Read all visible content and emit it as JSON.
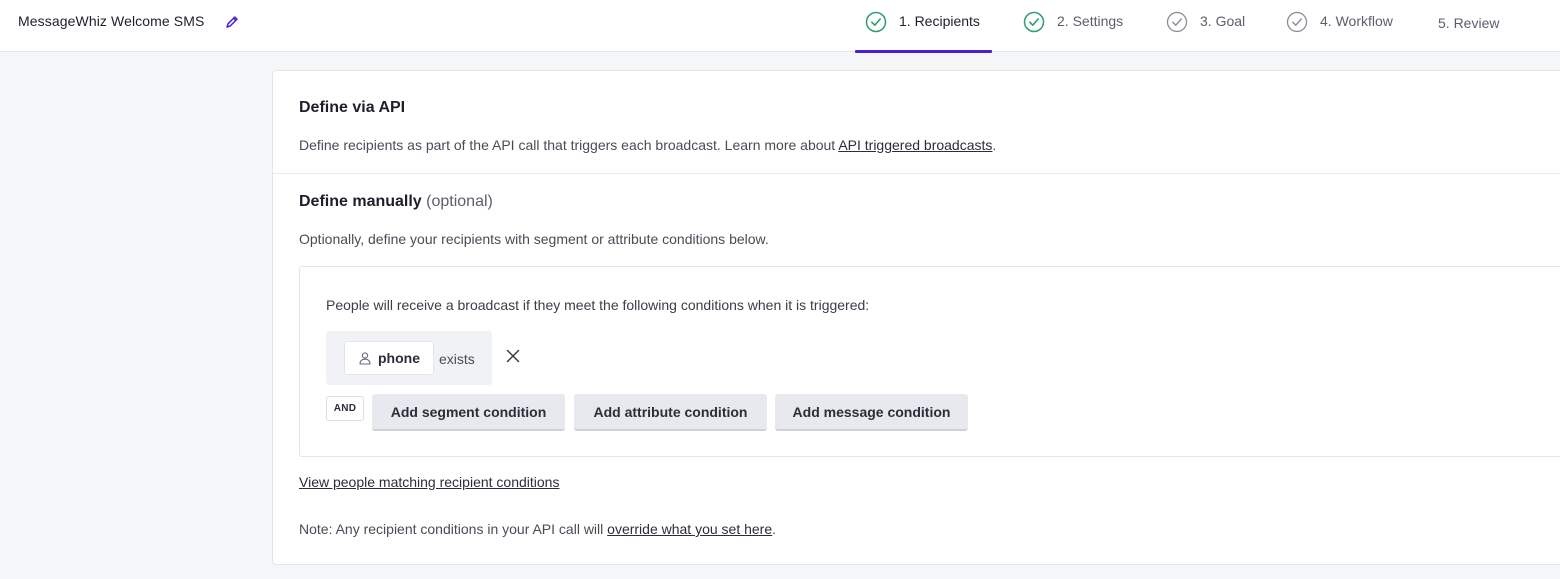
{
  "header": {
    "campaign_title": "MessageWhiz Welcome SMS",
    "steps": [
      {
        "label": "1. Recipients",
        "status": "completed",
        "active": true
      },
      {
        "label": "2. Settings",
        "status": "completed",
        "active": false
      },
      {
        "label": "3. Goal",
        "status": "pending-check",
        "active": false
      },
      {
        "label": "4. Workflow",
        "status": "pending-check",
        "active": false
      },
      {
        "label": "5. Review",
        "status": "none",
        "active": false
      }
    ]
  },
  "api_section": {
    "title": "Define via API",
    "description_prefix": "Define recipients as part of the API call that triggers each broadcast. Learn more about ",
    "description_link": "API triggered broadcasts",
    "description_suffix": "."
  },
  "manual_section": {
    "title": "Define manually",
    "title_optional": "(optional)",
    "description": "Optionally, define your recipients with segment or attribute conditions below.",
    "conditions_intro": "People will receive a broadcast if they meet the following conditions when it is triggered:",
    "condition": {
      "attribute": "phone",
      "operator": "exists",
      "icon": "person-icon"
    },
    "and_label": "AND",
    "buttons": {
      "segment": "Add segment condition",
      "attribute": "Add attribute condition",
      "message": "Add message condition"
    },
    "view_link": "View people matching recipient conditions",
    "note_prefix": "Note: Any recipient conditions in your API call will ",
    "note_link": "override what you set here",
    "note_suffix": "."
  },
  "colors": {
    "accent": "#4d1fd1",
    "completed_check": "#2e9e6f",
    "pending_check": "#8a8b96"
  }
}
